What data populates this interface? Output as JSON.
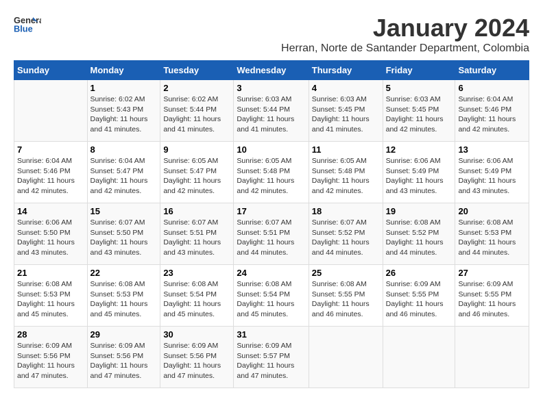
{
  "header": {
    "logo_general": "General",
    "logo_blue": "Blue",
    "month_title": "January 2024",
    "location": "Herran, Norte de Santander Department, Colombia"
  },
  "days_of_week": [
    "Sunday",
    "Monday",
    "Tuesday",
    "Wednesday",
    "Thursday",
    "Friday",
    "Saturday"
  ],
  "weeks": [
    [
      {
        "day": "",
        "sunrise": "",
        "sunset": "",
        "daylight": ""
      },
      {
        "day": "1",
        "sunrise": "6:02 AM",
        "sunset": "5:43 PM",
        "daylight": "11 hours and 41 minutes."
      },
      {
        "day": "2",
        "sunrise": "6:02 AM",
        "sunset": "5:44 PM",
        "daylight": "11 hours and 41 minutes."
      },
      {
        "day": "3",
        "sunrise": "6:03 AM",
        "sunset": "5:44 PM",
        "daylight": "11 hours and 41 minutes."
      },
      {
        "day": "4",
        "sunrise": "6:03 AM",
        "sunset": "5:45 PM",
        "daylight": "11 hours and 41 minutes."
      },
      {
        "day": "5",
        "sunrise": "6:03 AM",
        "sunset": "5:45 PM",
        "daylight": "11 hours and 42 minutes."
      },
      {
        "day": "6",
        "sunrise": "6:04 AM",
        "sunset": "5:46 PM",
        "daylight": "11 hours and 42 minutes."
      }
    ],
    [
      {
        "day": "7",
        "sunrise": "6:04 AM",
        "sunset": "5:46 PM",
        "daylight": "11 hours and 42 minutes."
      },
      {
        "day": "8",
        "sunrise": "6:04 AM",
        "sunset": "5:47 PM",
        "daylight": "11 hours and 42 minutes."
      },
      {
        "day": "9",
        "sunrise": "6:05 AM",
        "sunset": "5:47 PM",
        "daylight": "11 hours and 42 minutes."
      },
      {
        "day": "10",
        "sunrise": "6:05 AM",
        "sunset": "5:48 PM",
        "daylight": "11 hours and 42 minutes."
      },
      {
        "day": "11",
        "sunrise": "6:05 AM",
        "sunset": "5:48 PM",
        "daylight": "11 hours and 42 minutes."
      },
      {
        "day": "12",
        "sunrise": "6:06 AM",
        "sunset": "5:49 PM",
        "daylight": "11 hours and 43 minutes."
      },
      {
        "day": "13",
        "sunrise": "6:06 AM",
        "sunset": "5:49 PM",
        "daylight": "11 hours and 43 minutes."
      }
    ],
    [
      {
        "day": "14",
        "sunrise": "6:06 AM",
        "sunset": "5:50 PM",
        "daylight": "11 hours and 43 minutes."
      },
      {
        "day": "15",
        "sunrise": "6:07 AM",
        "sunset": "5:50 PM",
        "daylight": "11 hours and 43 minutes."
      },
      {
        "day": "16",
        "sunrise": "6:07 AM",
        "sunset": "5:51 PM",
        "daylight": "11 hours and 43 minutes."
      },
      {
        "day": "17",
        "sunrise": "6:07 AM",
        "sunset": "5:51 PM",
        "daylight": "11 hours and 44 minutes."
      },
      {
        "day": "18",
        "sunrise": "6:07 AM",
        "sunset": "5:52 PM",
        "daylight": "11 hours and 44 minutes."
      },
      {
        "day": "19",
        "sunrise": "6:08 AM",
        "sunset": "5:52 PM",
        "daylight": "11 hours and 44 minutes."
      },
      {
        "day": "20",
        "sunrise": "6:08 AM",
        "sunset": "5:53 PM",
        "daylight": "11 hours and 44 minutes."
      }
    ],
    [
      {
        "day": "21",
        "sunrise": "6:08 AM",
        "sunset": "5:53 PM",
        "daylight": "11 hours and 45 minutes."
      },
      {
        "day": "22",
        "sunrise": "6:08 AM",
        "sunset": "5:53 PM",
        "daylight": "11 hours and 45 minutes."
      },
      {
        "day": "23",
        "sunrise": "6:08 AM",
        "sunset": "5:54 PM",
        "daylight": "11 hours and 45 minutes."
      },
      {
        "day": "24",
        "sunrise": "6:08 AM",
        "sunset": "5:54 PM",
        "daylight": "11 hours and 45 minutes."
      },
      {
        "day": "25",
        "sunrise": "6:08 AM",
        "sunset": "5:55 PM",
        "daylight": "11 hours and 46 minutes."
      },
      {
        "day": "26",
        "sunrise": "6:09 AM",
        "sunset": "5:55 PM",
        "daylight": "11 hours and 46 minutes."
      },
      {
        "day": "27",
        "sunrise": "6:09 AM",
        "sunset": "5:55 PM",
        "daylight": "11 hours and 46 minutes."
      }
    ],
    [
      {
        "day": "28",
        "sunrise": "6:09 AM",
        "sunset": "5:56 PM",
        "daylight": "11 hours and 47 minutes."
      },
      {
        "day": "29",
        "sunrise": "6:09 AM",
        "sunset": "5:56 PM",
        "daylight": "11 hours and 47 minutes."
      },
      {
        "day": "30",
        "sunrise": "6:09 AM",
        "sunset": "5:56 PM",
        "daylight": "11 hours and 47 minutes."
      },
      {
        "day": "31",
        "sunrise": "6:09 AM",
        "sunset": "5:57 PM",
        "daylight": "11 hours and 47 minutes."
      },
      {
        "day": "",
        "sunrise": "",
        "sunset": "",
        "daylight": ""
      },
      {
        "day": "",
        "sunrise": "",
        "sunset": "",
        "daylight": ""
      },
      {
        "day": "",
        "sunrise": "",
        "sunset": "",
        "daylight": ""
      }
    ]
  ]
}
